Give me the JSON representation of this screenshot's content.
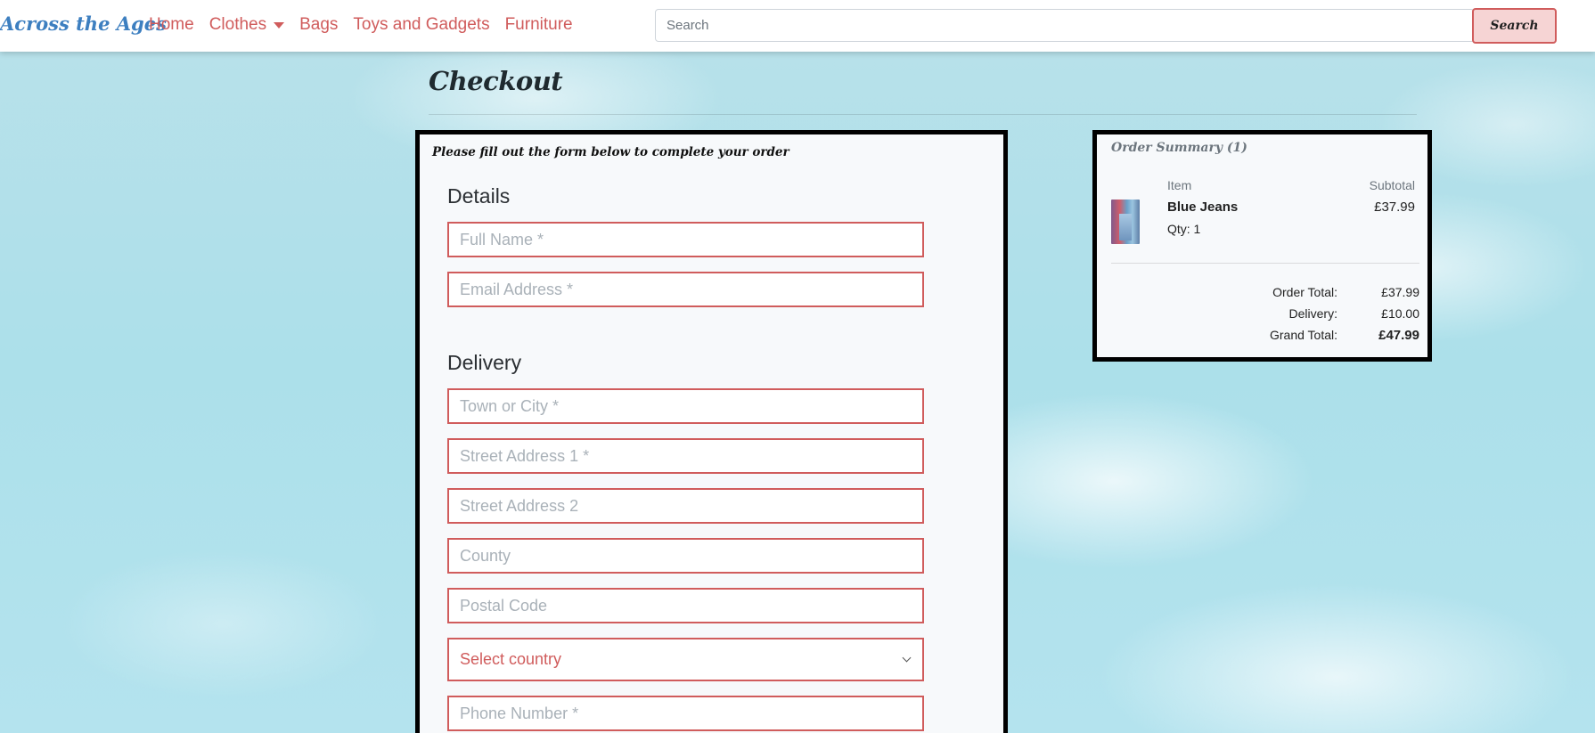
{
  "navbar": {
    "brand": "Across the Ages",
    "links": [
      "Home",
      "Clothes",
      "Bags",
      "Toys and Gadgets",
      "Furniture"
    ],
    "search_placeholder": "Search",
    "search_button": "Search"
  },
  "checkout": {
    "title": "Checkout",
    "intro": "Please fill out the form below to complete your order",
    "details_heading": "Details",
    "delivery_heading": "Delivery",
    "fields": {
      "full_name": "Full Name *",
      "email": "Email Address *",
      "town": "Town or City *",
      "street1": "Street Address 1 *",
      "street2": "Street Address 2",
      "county": "County",
      "postcode": "Postal Code",
      "country": "Select country",
      "phone": "Phone Number *"
    }
  },
  "summary": {
    "title": "Order Summary (1)",
    "col_item": "Item",
    "col_subtotal": "Subtotal",
    "item_name": "Blue Jeans",
    "item_qty": "Qty: 1",
    "item_price": "£37.99",
    "order_total_label": "Order Total:",
    "order_total": "£37.99",
    "delivery_label": "Delivery:",
    "delivery": "£10.00",
    "grand_total_label": "Grand Total:",
    "grand_total": "£47.99"
  },
  "colors": {
    "accent": "#d05c5c",
    "brand": "#3d7fc0"
  }
}
